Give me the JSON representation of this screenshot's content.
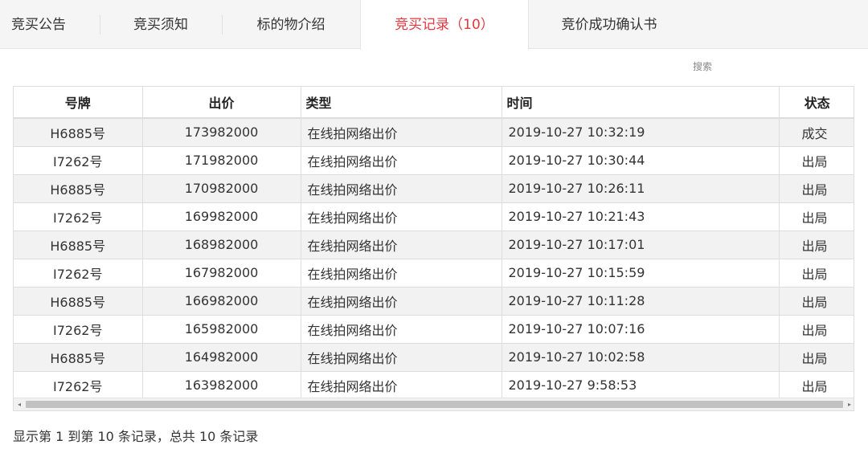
{
  "tabs": [
    {
      "label": "竞买公告"
    },
    {
      "label": "竞买须知"
    },
    {
      "label": "标的物介绍"
    },
    {
      "label": "竞买记录（10）"
    },
    {
      "label": "竞价成功确认书"
    }
  ],
  "active_tab": "竞买记录（10）",
  "accent_color": "#e2383f",
  "search": {
    "label": "搜索"
  },
  "table": {
    "headers": {
      "number": "号牌",
      "price": "出价",
      "type": "类型",
      "time": "时间",
      "status": "状态"
    },
    "rows": [
      {
        "number": "H6885号",
        "price": "173982000",
        "type": "在线拍网络出价",
        "time": "2019-10-27 10:32:19",
        "status": "成交"
      },
      {
        "number": "I7262号",
        "price": "171982000",
        "type": "在线拍网络出价",
        "time": "2019-10-27 10:30:44",
        "status": "出局"
      },
      {
        "number": "H6885号",
        "price": "170982000",
        "type": "在线拍网络出价",
        "time": "2019-10-27 10:26:11",
        "status": "出局"
      },
      {
        "number": "I7262号",
        "price": "169982000",
        "type": "在线拍网络出价",
        "time": "2019-10-27 10:21:43",
        "status": "出局"
      },
      {
        "number": "H6885号",
        "price": "168982000",
        "type": "在线拍网络出价",
        "time": "2019-10-27 10:17:01",
        "status": "出局"
      },
      {
        "number": "I7262号",
        "price": "167982000",
        "type": "在线拍网络出价",
        "time": "2019-10-27 10:15:59",
        "status": "出局"
      },
      {
        "number": "H6885号",
        "price": "166982000",
        "type": "在线拍网络出价",
        "time": "2019-10-27 10:11:28",
        "status": "出局"
      },
      {
        "number": "I7262号",
        "price": "165982000",
        "type": "在线拍网络出价",
        "time": "2019-10-27 10:07:16",
        "status": "出局"
      },
      {
        "number": "H6885号",
        "price": "164982000",
        "type": "在线拍网络出价",
        "time": "2019-10-27 10:02:58",
        "status": "出局"
      },
      {
        "number": "I7262号",
        "price": "163982000",
        "type": "在线拍网络出价",
        "time": "2019-10-27 9:58:53",
        "status": "出局"
      }
    ]
  },
  "scrollbar": {
    "left_arrow": "◂",
    "right_arrow": "▸"
  },
  "pagination": {
    "summary": "显示第 1 到第 10 条记录，总共 10 条记录"
  }
}
